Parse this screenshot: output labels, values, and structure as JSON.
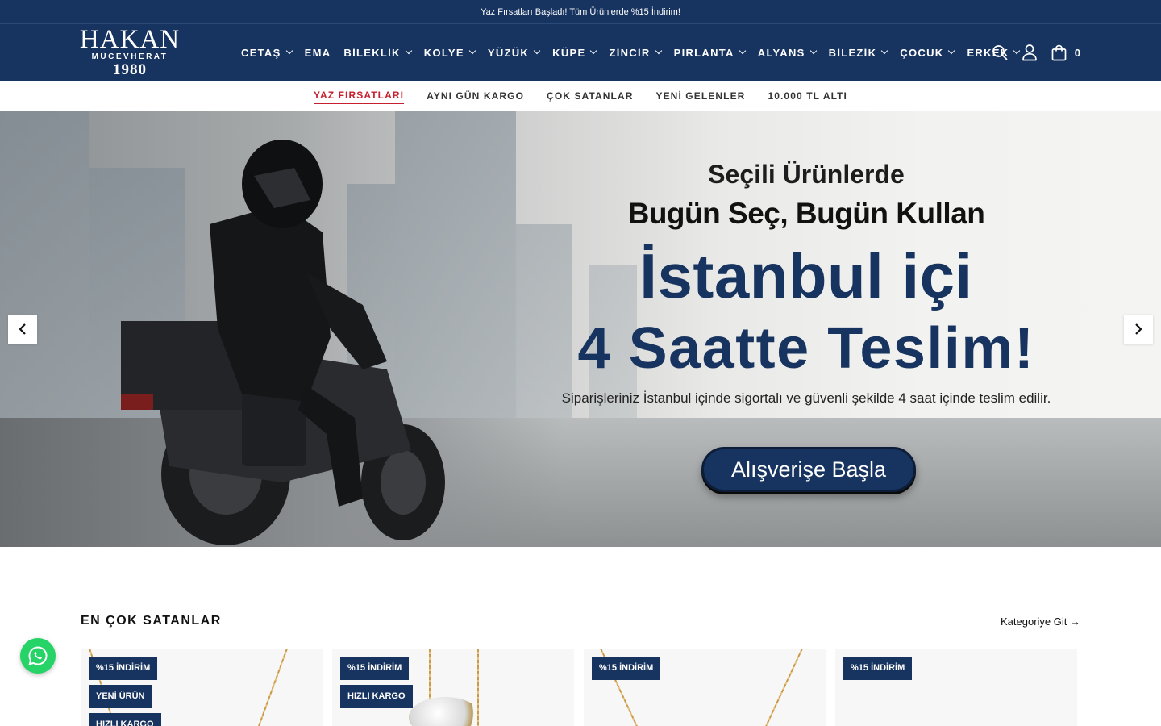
{
  "announcement": "Yaz Fırsatları Başladı! Tüm Ürünlerde %15 İndirim!",
  "logo": {
    "line1": "HAKAN",
    "line2": "MÜCEVHERAT",
    "line3": "1980"
  },
  "main_nav": [
    {
      "label": "CETAŞ",
      "has_dropdown": true
    },
    {
      "label": "EMA",
      "has_dropdown": false
    },
    {
      "label": "BİLEKLİK",
      "has_dropdown": true
    },
    {
      "label": "KOLYE",
      "has_dropdown": true
    },
    {
      "label": "YÜZÜK",
      "has_dropdown": true
    },
    {
      "label": "KÜPE",
      "has_dropdown": true
    },
    {
      "label": "ZİNCİR",
      "has_dropdown": true
    },
    {
      "label": "PIRLANTA",
      "has_dropdown": true
    },
    {
      "label": "ALYANS",
      "has_dropdown": true
    },
    {
      "label": "BİLEZİK",
      "has_dropdown": true
    },
    {
      "label": "ÇOCUK",
      "has_dropdown": true
    },
    {
      "label": "ERKEK",
      "has_dropdown": true
    }
  ],
  "tools": {
    "search_icon": "search-icon",
    "account_icon": "user-icon",
    "cart_icon": "bag-icon",
    "cart_count": "0"
  },
  "sub_nav": [
    {
      "label": "YAZ FIRSATLARI",
      "active": true
    },
    {
      "label": "AYNI GÜN KARGO",
      "active": false
    },
    {
      "label": "ÇOK SATANLAR",
      "active": false
    },
    {
      "label": "YENİ GELENLER",
      "active": false
    },
    {
      "label": "10.000 TL ALTI",
      "active": false
    }
  ],
  "hero": {
    "line1": "Seçili Ürünlerde",
    "line2": "Bugün Seç, Bugün Kullan",
    "line3": "İstanbul içi",
    "line4": "4 Saatte Teslim!",
    "line5": "Siparişleriniz İstanbul içinde sigortalı ve güvenli şekilde 4 saat içinde teslim edilir.",
    "button": "Alışverişe Başla"
  },
  "best_sellers": {
    "title": "EN ÇOK SATANLAR",
    "link": "Kategoriye Git",
    "products": [
      {
        "badges": [
          "%15 İNDİRİM",
          "YENİ ÜRÜN",
          "HIZLI KARGO"
        ]
      },
      {
        "badges": [
          "%15 İNDİRİM",
          "HIZLI KARGO"
        ]
      },
      {
        "badges": [
          "%15 İNDİRİM"
        ]
      },
      {
        "badges": [
          "%15 İNDİRİM"
        ]
      }
    ]
  },
  "colors": {
    "brand_navy": "#17335f",
    "accent_red": "#c6202e",
    "whatsapp_green": "#25d366"
  }
}
